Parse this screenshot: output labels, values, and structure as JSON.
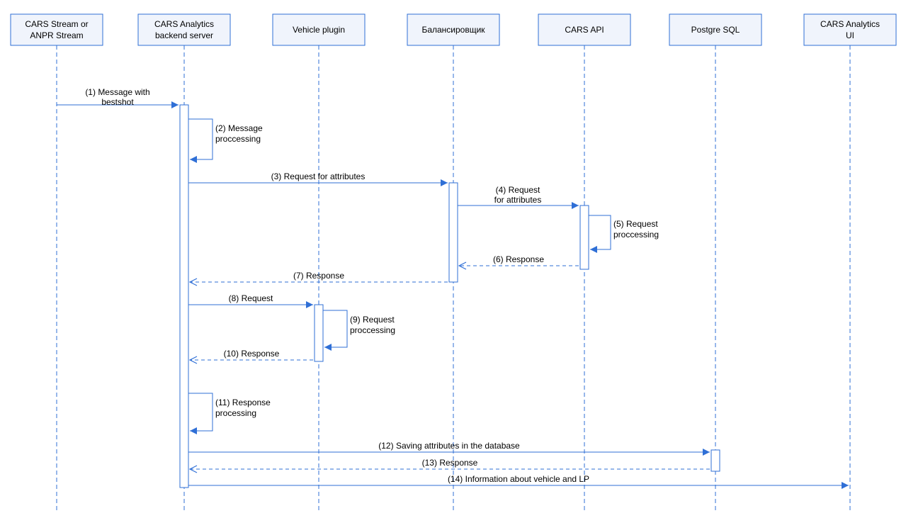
{
  "participants": [
    {
      "id": "p0",
      "label_line1": "CARS Stream or",
      "label_line2": "ANPR Stream"
    },
    {
      "id": "p1",
      "label_line1": "CARS Analytics",
      "label_line2": "backend server"
    },
    {
      "id": "p2",
      "label_line1": "Vehicle plugin",
      "label_line2": ""
    },
    {
      "id": "p3",
      "label_line1": "Балансировщик",
      "label_line2": ""
    },
    {
      "id": "p4",
      "label_line1": "CARS API",
      "label_line2": ""
    },
    {
      "id": "p5",
      "label_line1": "Postgre SQL",
      "label_line2": ""
    },
    {
      "id": "p6",
      "label_line1": "CARS Analytics",
      "label_line2": "UI"
    }
  ],
  "messages": {
    "m1_line1": "(1) Message with",
    "m1_line2": "bestshot",
    "m2_line1": "(2) Message",
    "m2_line2": "proccessing",
    "m3": "(3) Request for attributes",
    "m4_line1": "(4) Request",
    "m4_line2": "for attributes",
    "m5_line1": "(5) Request",
    "m5_line2": "proccessing",
    "m6": "(6) Response",
    "m7": "(7) Response",
    "m8": "(8) Request",
    "m9_line1": "(9) Request",
    "m9_line2": "proccessing",
    "m10": "(10) Response",
    "m11_line1": "(11) Response",
    "m11_line2": "processing",
    "m12": "(12) Saving attributes in the database",
    "m13": "(13) Response",
    "m14": "(14) Information about vehicle and LP"
  }
}
